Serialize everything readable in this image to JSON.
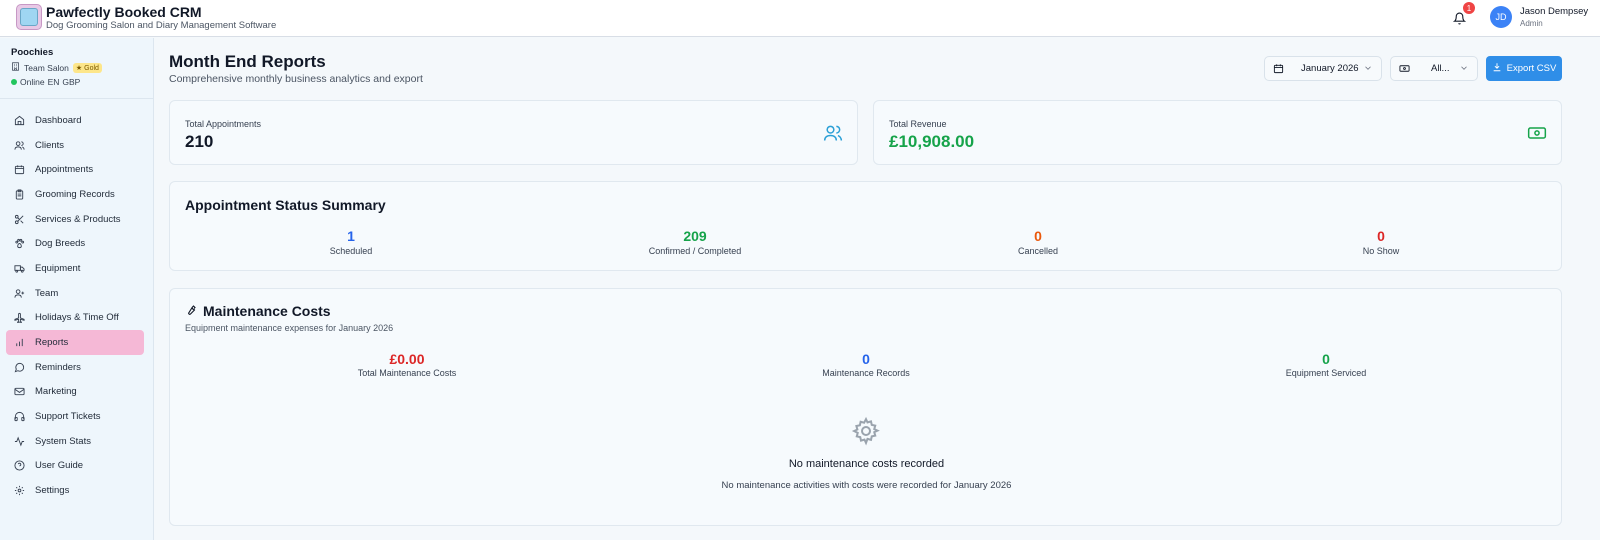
{
  "header": {
    "app_title": "Pawfectly Booked CRM",
    "app_subtitle": "Dog Grooming Salon and Diary Management Software",
    "notification_count": "1",
    "user_initials": "JD",
    "user_name": "Jason Dempsey",
    "user_role": "Admin"
  },
  "sidebar": {
    "org_name": "Poochies",
    "team_name": "Team Salon",
    "tier_badge": "Gold",
    "status": "Online",
    "language": "EN",
    "currency": "GBP",
    "items": [
      {
        "label": "Dashboard",
        "icon": "home-icon"
      },
      {
        "label": "Clients",
        "icon": "users-icon"
      },
      {
        "label": "Appointments",
        "icon": "calendar-icon"
      },
      {
        "label": "Grooming Records",
        "icon": "clipboard-icon"
      },
      {
        "label": "Services & Products",
        "icon": "scissors-icon"
      },
      {
        "label": "Dog Breeds",
        "icon": "paw-icon"
      },
      {
        "label": "Equipment",
        "icon": "truck-icon"
      },
      {
        "label": "Team",
        "icon": "user-plus-icon"
      },
      {
        "label": "Holidays & Time Off",
        "icon": "plane-icon"
      },
      {
        "label": "Reports",
        "icon": "bar-chart-icon",
        "active": true
      },
      {
        "label": "Reminders",
        "icon": "message-icon"
      },
      {
        "label": "Marketing",
        "icon": "mail-icon"
      },
      {
        "label": "Support Tickets",
        "icon": "headphones-icon"
      },
      {
        "label": "System Stats",
        "icon": "activity-icon"
      },
      {
        "label": "User Guide",
        "icon": "help-circle-icon"
      },
      {
        "label": "Settings",
        "icon": "gear-icon"
      }
    ]
  },
  "page": {
    "title": "Month End Reports",
    "subtitle": "Comprehensive monthly business analytics and export",
    "month_select": "January 2026",
    "filter_select": "All...",
    "export_label": "Export CSV"
  },
  "summary": {
    "appointments_label": "Total Appointments",
    "appointments_value": "210",
    "revenue_label": "Total Revenue",
    "revenue_value": "£10,908.00"
  },
  "status_summary": {
    "title": "Appointment Status Summary",
    "items": [
      {
        "value": "1",
        "label": "Scheduled",
        "color": "#2563eb"
      },
      {
        "value": "209",
        "label": "Confirmed / Completed",
        "color": "#16a34a"
      },
      {
        "value": "0",
        "label": "Cancelled",
        "color": "#ea580c"
      },
      {
        "value": "0",
        "label": "No Show",
        "color": "#dc2626"
      }
    ]
  },
  "maintenance": {
    "title": "Maintenance Costs",
    "subtitle": "Equipment maintenance expenses for January 2026",
    "stats": [
      {
        "value": "£0.00",
        "label": "Total Maintenance Costs",
        "color": "#dc2626"
      },
      {
        "value": "0",
        "label": "Maintenance Records",
        "color": "#2563eb"
      },
      {
        "value": "0",
        "label": "Equipment Serviced",
        "color": "#16a34a"
      }
    ],
    "empty_title": "No maintenance costs recorded",
    "empty_subtitle": "No maintenance activities with costs were recorded for January 2026"
  },
  "colors": {
    "accent": "#2f8ee8",
    "active_nav": "#f5b8d6",
    "revenue": "#16a34a",
    "appointments_icon": "#2a9fd6"
  }
}
